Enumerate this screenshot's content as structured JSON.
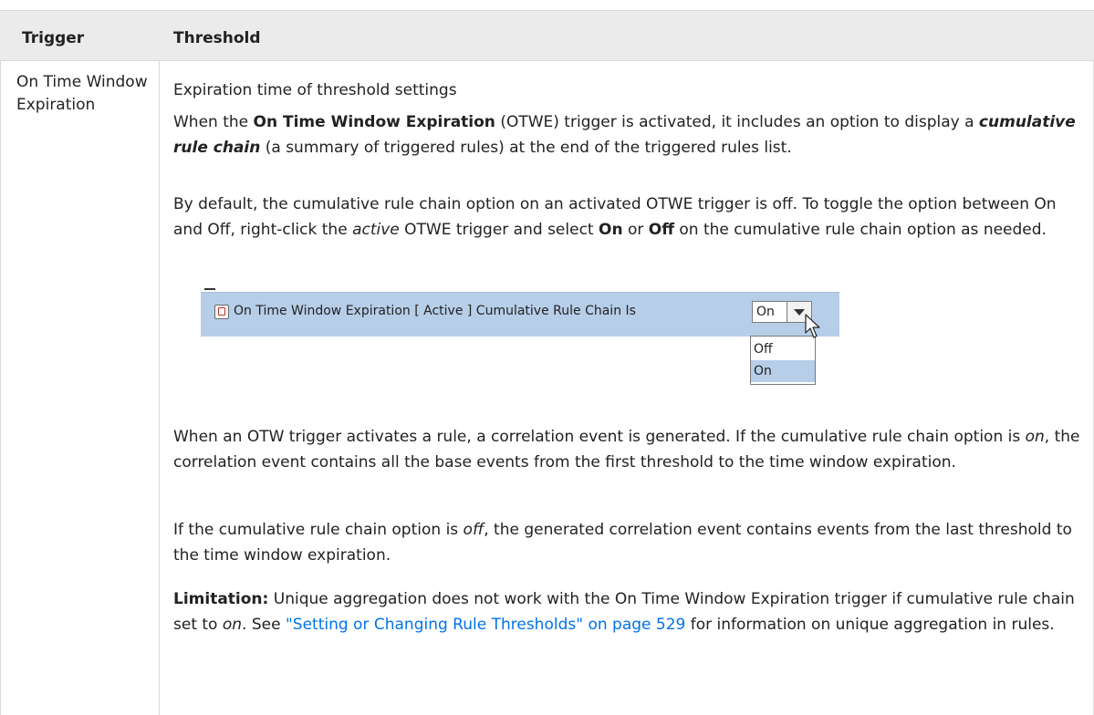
{
  "table": {
    "headers": {
      "trigger": "Trigger",
      "threshold": "Threshold"
    },
    "row": {
      "trigger_label": "On Time Window Expiration",
      "p1": "Expiration time of threshold settings",
      "p2": {
        "a": "When the ",
        "b": "On Time Window Expiration",
        "c": " (OTWE) trigger is activated, it includes an option to display a ",
        "d": "cumulative rule chain",
        "e": " (a summary of triggered rules) at the end of the triggered rules list."
      },
      "p3": {
        "a": "By default, the cumulative rule chain option on an activated OTWE trigger is off. To toggle the option between On and Off, right-click the ",
        "b": "active",
        "c": " OTWE trigger and select ",
        "d": "On",
        "e": " or ",
        "f": "Off",
        "g": " on the cumulative rule chain option as needed."
      },
      "screenshot": {
        "text": "On Time Window Expiration [ Active ] Cumulative Rule Chain Is",
        "selected": "On",
        "options": [
          "Off",
          "On"
        ]
      },
      "p4": {
        "a": "When an OTW trigger activates a rule, a correlation event is generated. If the cumulative rule chain option is ",
        "b": "on",
        "c": ", the correlation event contains all the base events from the first threshold to the time window expiration."
      },
      "p5": {
        "a": "If the cumulative rule chain option is ",
        "b": "off",
        "c": ", the generated correlation event contains events from the last threshold to the time window expiration."
      },
      "p6": {
        "a": "Limitation:",
        "b": " Unique aggregation does not work with the On Time Window Expiration trigger if cumulative rule chain set to ",
        "c": "on",
        "d": ". See ",
        "link": "\"Setting or Changing Rule Thresholds\" on page 529",
        "e": " for information on unique aggregation in rules."
      }
    }
  }
}
